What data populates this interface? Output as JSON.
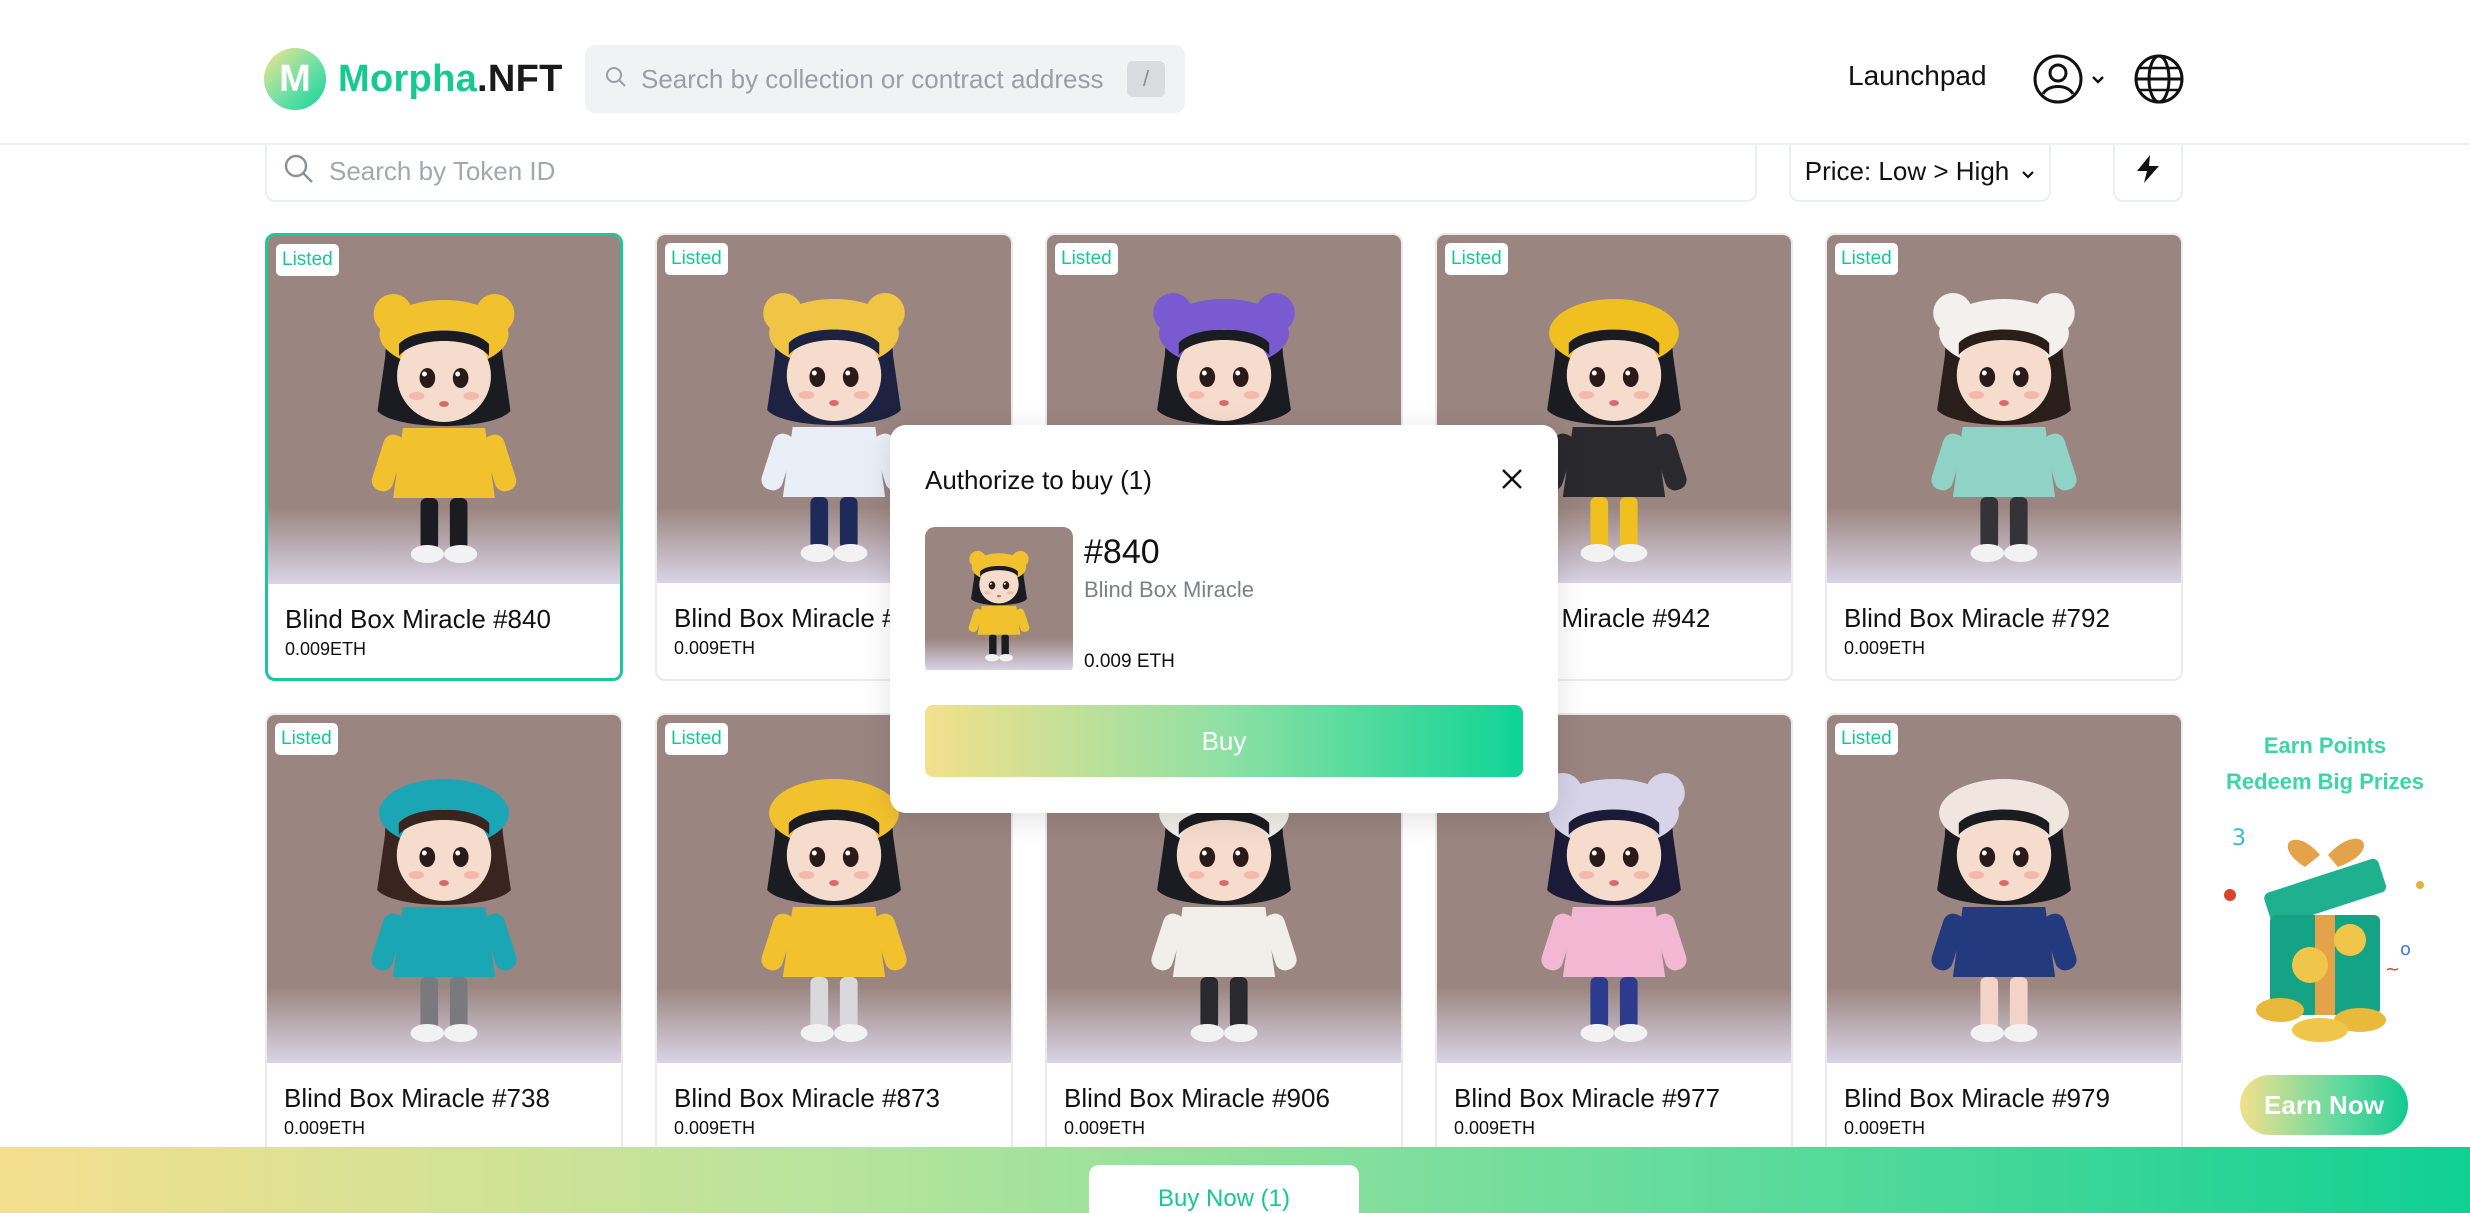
{
  "header": {
    "logo_mark": "M",
    "logo_text_a": "Morpha",
    "logo_text_b": ".NFT",
    "search_placeholder": "Search by collection or contract address",
    "search_shortcut": "/",
    "launchpad_label": "Launchpad"
  },
  "filters": {
    "token_search_placeholder": "Search by Token ID",
    "sort_label": "Price: Low > High"
  },
  "items": [
    {
      "badge": "Listed",
      "name": "Blind Box Miracle #840",
      "price": "0.009ETH",
      "bg": "#9b8580",
      "hat": "#f2c22e",
      "hair": "#1b1b22",
      "coat": "#f2c22e",
      "legs": "#1b1b22",
      "ears": true
    },
    {
      "badge": "Listed",
      "name": "Blind Box Miracle #",
      "price": "0.009ETH",
      "bg": "#a68f87",
      "hat": "#f0c545",
      "hair": "#1d2240",
      "coat": "#eaeef6",
      "legs": "#1d2a5a",
      "ears": true
    },
    {
      "badge": "Listed",
      "name": "",
      "price": "",
      "bg": "#a98ca0",
      "hat": "#7a5ad0",
      "hair": "#1b1b22",
      "coat": "#2b3fd6",
      "legs": "#2b3fd6",
      "ears": true
    },
    {
      "badge": "Listed",
      "name": "t Miracle #942",
      "price": "",
      "bg": "#8f8f94",
      "hat": "#f0c020",
      "hair": "#1b1b22",
      "coat": "#2a2a2e",
      "legs": "#f0c020",
      "ears": false
    },
    {
      "badge": "Listed",
      "name": "Blind Box Miracle #792",
      "price": "0.009ETH",
      "bg": "#9f9a9e",
      "hat": "#f4f0ee",
      "hair": "#2a1e1a",
      "coat": "#8fd3c7",
      "legs": "#333338",
      "ears": true
    },
    {
      "badge": "Listed",
      "name": "Blind Box Miracle #738",
      "price": "0.009ETH",
      "bg": "#9d8786",
      "hat": "#1ba6b6",
      "hair": "#3a2420",
      "coat": "#1ba6b6",
      "legs": "#7a7a7e",
      "ears": false
    },
    {
      "badge": "Listed",
      "name": "Blind Box Miracle #873",
      "price": "0.009ETH",
      "bg": "#6f6f74",
      "hat": "#f2c22e",
      "hair": "#1b1b22",
      "coat": "#f2c22e",
      "legs": "#d9d9dc",
      "ears": false
    },
    {
      "badge": "",
      "name": "Blind Box Miracle #906",
      "price": "0.009ETH",
      "bg": "#b59a8c",
      "hat": "#f0efe9",
      "hair": "#1b1b22",
      "coat": "#f0efe9",
      "legs": "#2a2a2e",
      "ears": false
    },
    {
      "badge": "",
      "name": "Blind Box Miracle #977",
      "price": "0.009ETH",
      "bg": "#8c7470",
      "hat": "#d7d3e9",
      "hair": "#1b1b38",
      "coat": "#f2b8d3",
      "legs": "#2c3b8e",
      "ears": true
    },
    {
      "badge": "Listed",
      "name": "Blind Box Miracle #979",
      "price": "0.009ETH",
      "bg": "#a39a99",
      "hat": "#f1e6df",
      "hair": "#1b1b22",
      "coat": "#233a7e",
      "legs": "#f3d2c7",
      "ears": false
    }
  ],
  "modal": {
    "title": "Authorize to buy (1)",
    "token": "#840",
    "collection": "Blind Box Miracle",
    "price": "0.009 ETH",
    "buy_label": "Buy"
  },
  "promo": {
    "line1": "Earn Points",
    "line2": "Redeem Big Prizes",
    "button": "Earn Now"
  },
  "bottom_bar": {
    "buy_now_label": "Buy Now (1)"
  },
  "colors": {
    "accent": "#16c990",
    "gradient_start": "#f3e08c",
    "gradient_end": "#0fd496"
  }
}
